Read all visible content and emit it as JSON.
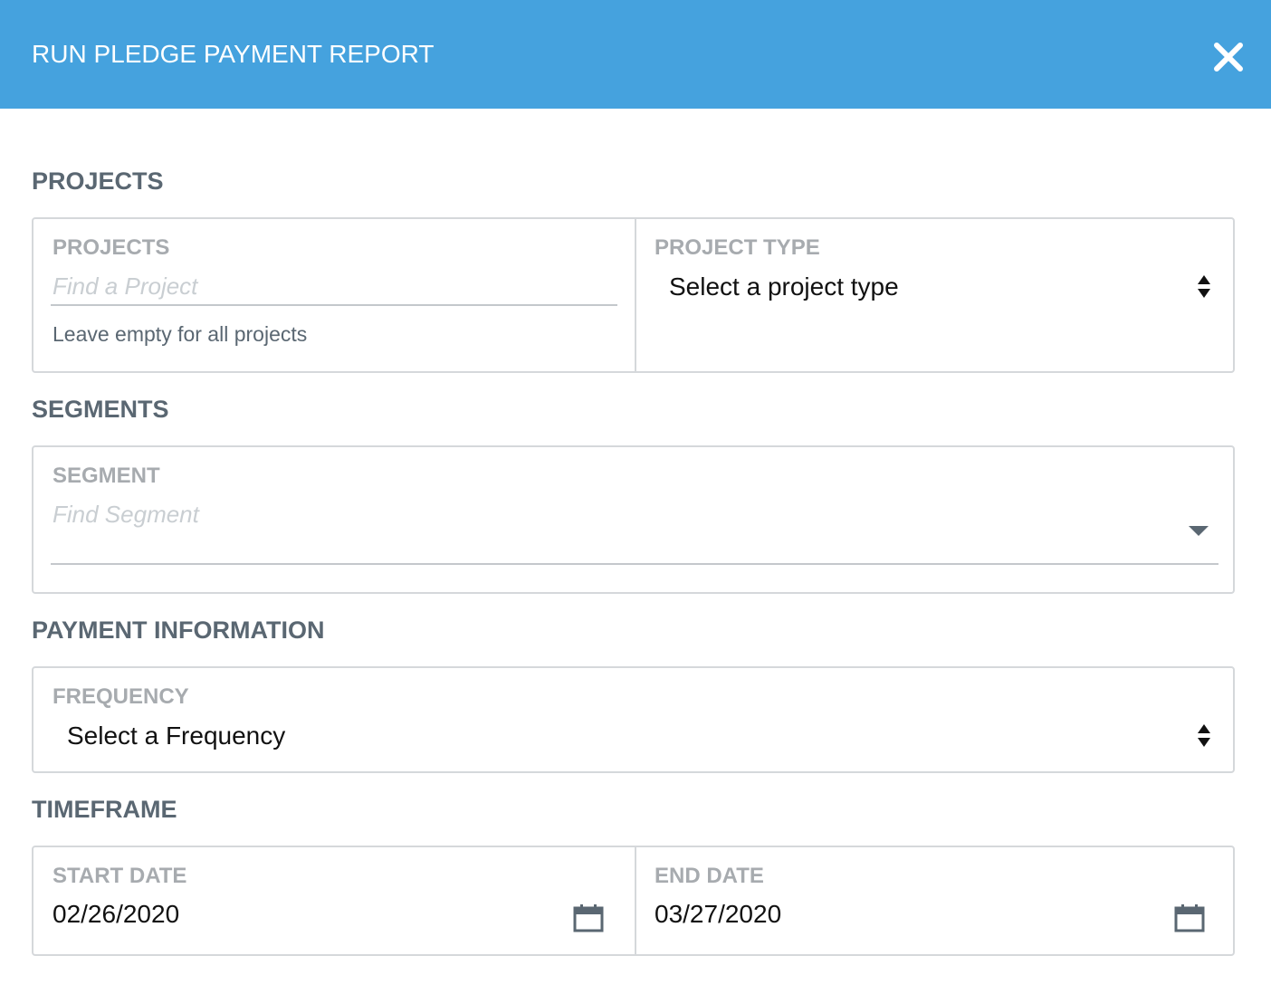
{
  "header": {
    "title": "RUN PLEDGE PAYMENT REPORT",
    "close_icon": "close-icon",
    "background": "#45a2de"
  },
  "sections": {
    "projects": {
      "title": "PROJECTS",
      "projects_field": {
        "label": "PROJECTS",
        "placeholder": "Find a Project",
        "helper": "Leave empty for all projects"
      },
      "project_type_field": {
        "label": "PROJECT TYPE",
        "value": "Select a project type",
        "icon": "sort-arrows-icon"
      }
    },
    "segments": {
      "title": "SEGMENTS",
      "segment_field": {
        "label": "SEGMENT",
        "placeholder": "Find Segment",
        "icon": "caret-down-icon"
      }
    },
    "payment": {
      "title": "PAYMENT INFORMATION",
      "frequency_field": {
        "label": "FREQUENCY",
        "value": "Select a Frequency",
        "icon": "sort-arrows-icon"
      }
    },
    "timeframe": {
      "title": "TIMEFRAME",
      "start_date": {
        "label": "START DATE",
        "value": "02/26/2020",
        "icon": "calendar-icon"
      },
      "end_date": {
        "label": "END DATE",
        "value": "03/27/2020",
        "icon": "calendar-icon"
      }
    }
  }
}
